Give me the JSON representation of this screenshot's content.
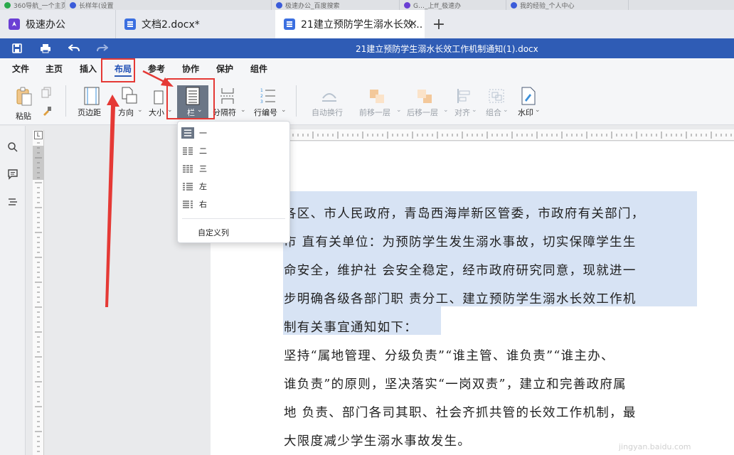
{
  "browser_strip": {
    "tabs": [
      "360导航_一个主页",
      "长样年(设置",
      "极速办公_百度搜索",
      "G…_上ff_极速办",
      "我的经验_个人中心"
    ]
  },
  "tabs": {
    "home": "极速办公",
    "doc1": "文档2.docx*",
    "active": "21建立预防学生溺水长效...",
    "close_glyph": "✕",
    "add_glyph": "+"
  },
  "titlebar": {
    "document_title": "21建立预防学生溺水长效工作机制通知(1).docx",
    "icons": [
      "save-icon",
      "print-icon",
      "undo-icon",
      "redo-icon"
    ]
  },
  "menu": {
    "items": [
      "文件",
      "主页",
      "插入",
      "布局",
      "参考",
      "协作",
      "保护",
      "组件"
    ],
    "active": "布局"
  },
  "ribbon": {
    "paste": "粘贴",
    "margins": "页边距",
    "orientation": "方向",
    "size": "大小",
    "columns": "栏",
    "breaks": "分隔符",
    "line_numbers": "行编号",
    "wrap": "自动换行",
    "bring_forward": "前移一层",
    "send_backward": "后移一层",
    "align": "对齐",
    "group": "组合",
    "watermark": "水印"
  },
  "columns_menu": {
    "items": [
      "一",
      "二",
      "三",
      "左",
      "右"
    ],
    "custom": "自定义列"
  },
  "document": {
    "paragraphs": [
      {
        "text": "各区、市人民政府，青岛西海岸新区管委，市政府有关部门，"
      },
      {
        "text": "市    直有关单位：为预防学生发生溺水事故，切实保障学生生"
      },
      {
        "text": "命安全，维护社    会安全稳定，经市政府研究同意，现就进一"
      },
      {
        "text": "步明确各级各部门职    责分工、建立预防学生溺水长效工作机"
      },
      {
        "text": "制有关事宜通知如下："
      },
      {
        "text": "坚持“属地管理、分级负责”“谁主管、谁负责”“谁主办、"
      },
      {
        "text": "谁负责”的原则，坚决落实“一岗双责”，建立和完善政府属"
      },
      {
        "text": "地    负责、部门各司其职、社会齐抓共管的长效工作机制，最"
      },
      {
        "text": "大限度减少学生溺水事故发生。"
      }
    ]
  },
  "watermark": "jingyan.baidu.com",
  "colors": {
    "titlebar": "#2f5cb5",
    "selection": "#d7e3f4",
    "highlight": "#e53935"
  }
}
